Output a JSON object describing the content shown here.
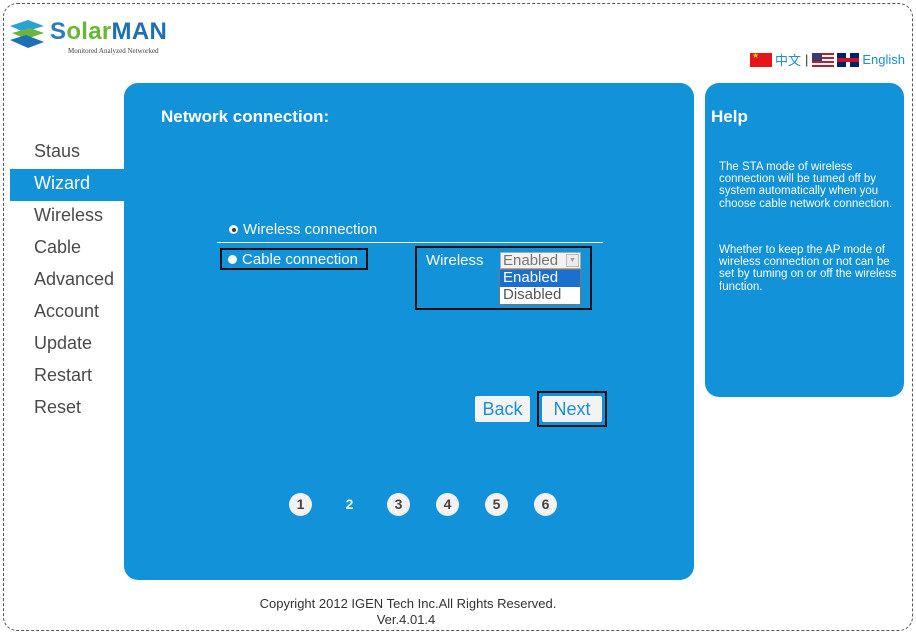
{
  "brand": {
    "name_prefix": "S",
    "name_accent": "olar",
    "name_suffix": "MAN",
    "tagline": "Monitored Analyzed Networked"
  },
  "language": {
    "chinese": "中文",
    "separator": "|",
    "english": "English"
  },
  "sidebar": {
    "items": [
      {
        "label": "Staus",
        "active": false
      },
      {
        "label": "Wizard",
        "active": true
      },
      {
        "label": "Wireless",
        "active": false
      },
      {
        "label": "Cable",
        "active": false
      },
      {
        "label": "Advanced",
        "active": false
      },
      {
        "label": "Account",
        "active": false
      },
      {
        "label": "Update",
        "active": false
      },
      {
        "label": "Restart",
        "active": false
      },
      {
        "label": "Reset",
        "active": false
      }
    ]
  },
  "main": {
    "title": "Network connection:",
    "options": {
      "wireless_label": "Wireless connection",
      "wireless_checked": true,
      "cable_label": "Cable connection",
      "cable_checked": false
    },
    "wireless_select": {
      "label": "Wireless",
      "value": "Enabled",
      "options": [
        "Enabled",
        "Disabled"
      ],
      "highlighted": "Enabled"
    },
    "buttons": {
      "back": "Back",
      "next": "Next"
    },
    "steps": [
      "1",
      "2",
      "3",
      "4",
      "5",
      "6"
    ],
    "current_step": "2"
  },
  "help": {
    "title": "Help",
    "paragraphs": [
      "The STA mode of wireless connection will be tumed off by system automatically when you choose cable network connection.",
      "Whether to keep the AP mode of wireless connection or not can be set by tuming on or off the wireless function."
    ]
  },
  "footer": {
    "copyright": "Copyright   2012 IGEN Tech Inc.All Rights Reserved.",
    "version": "Ver.4.01.4"
  },
  "colors": {
    "panel_blue": "#1292d8",
    "link_blue": "#1a8fd9",
    "brand_green": "#6bb638"
  },
  "icons": [
    "solarman-logo-icon",
    "china-flag-icon",
    "us-flag-icon",
    "uk-flag-icon"
  ]
}
